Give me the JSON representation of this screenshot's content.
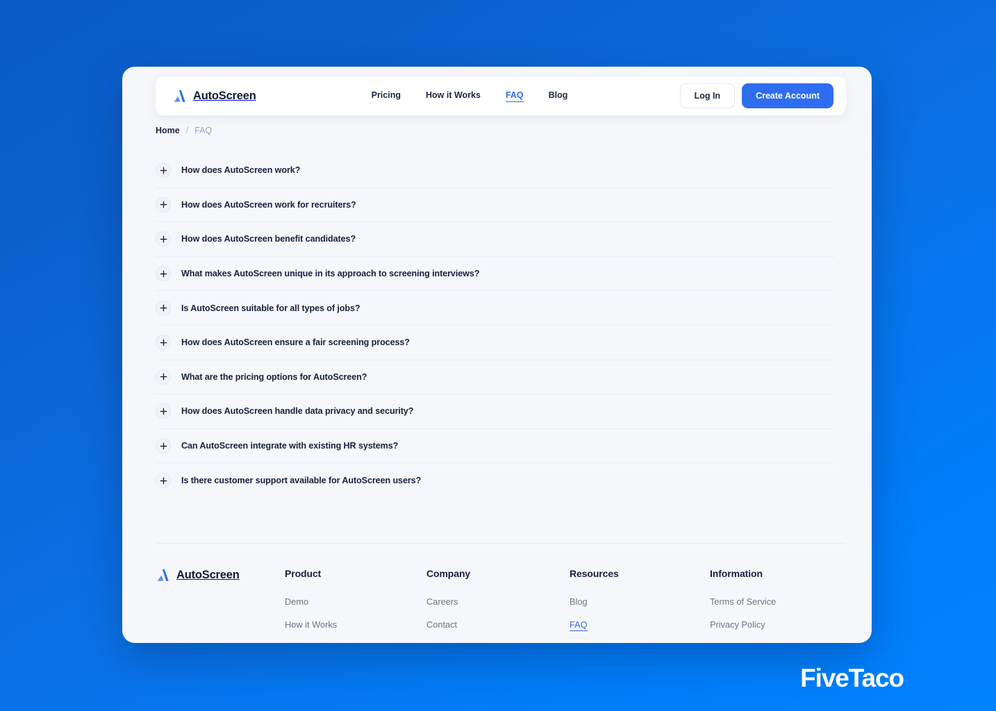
{
  "brand": {
    "name": "AutoScreen",
    "logo_icon": "autoscreen-a-logo",
    "accent": "#2f6df0"
  },
  "navbar": {
    "links": [
      {
        "label": "Pricing",
        "active": false
      },
      {
        "label": "How it Works",
        "active": false
      },
      {
        "label": "FAQ",
        "active": true
      },
      {
        "label": "Blog",
        "active": false
      }
    ],
    "login_label": "Log In",
    "create_account_label": "Create Account"
  },
  "breadcrumb": {
    "home": "Home",
    "separator": "/",
    "current": "FAQ"
  },
  "faq": {
    "items": [
      {
        "question": "How does AutoScreen work?",
        "icon": "plus-icon",
        "expanded": false
      },
      {
        "question": "How does AutoScreen work for recruiters?",
        "icon": "plus-icon",
        "expanded": false
      },
      {
        "question": "How does AutoScreen benefit candidates?",
        "icon": "plus-icon",
        "expanded": false
      },
      {
        "question": "What makes AutoScreen unique in its approach to screening interviews?",
        "icon": "plus-icon",
        "expanded": false
      },
      {
        "question": "Is AutoScreen suitable for all types of jobs?",
        "icon": "plus-icon",
        "expanded": false
      },
      {
        "question": "How does AutoScreen ensure a fair screening process?",
        "icon": "plus-icon",
        "expanded": false
      },
      {
        "question": "What are the pricing options for AutoScreen?",
        "icon": "plus-icon",
        "expanded": false
      },
      {
        "question": "How does AutoScreen handle data privacy and security?",
        "icon": "plus-icon",
        "expanded": false
      },
      {
        "question": "Can AutoScreen integrate with existing HR systems?",
        "icon": "plus-icon",
        "expanded": false
      },
      {
        "question": "Is there customer support available for AutoScreen users?",
        "icon": "plus-icon",
        "expanded": false
      }
    ]
  },
  "footer": {
    "brand_name": "AutoScreen",
    "columns": [
      {
        "heading": "Product",
        "links": [
          {
            "label": "Demo",
            "active": false
          },
          {
            "label": "How it Works",
            "active": false
          }
        ]
      },
      {
        "heading": "Company",
        "links": [
          {
            "label": "Careers",
            "active": false
          },
          {
            "label": "Contact",
            "active": false
          }
        ]
      },
      {
        "heading": "Resources",
        "links": [
          {
            "label": "Blog",
            "active": false
          },
          {
            "label": "FAQ",
            "active": true
          }
        ]
      },
      {
        "heading": "Information",
        "links": [
          {
            "label": "Terms of Service",
            "active": false
          },
          {
            "label": "Privacy Policy",
            "active": false
          }
        ]
      }
    ]
  },
  "watermark": {
    "text": "FiveTaco"
  }
}
